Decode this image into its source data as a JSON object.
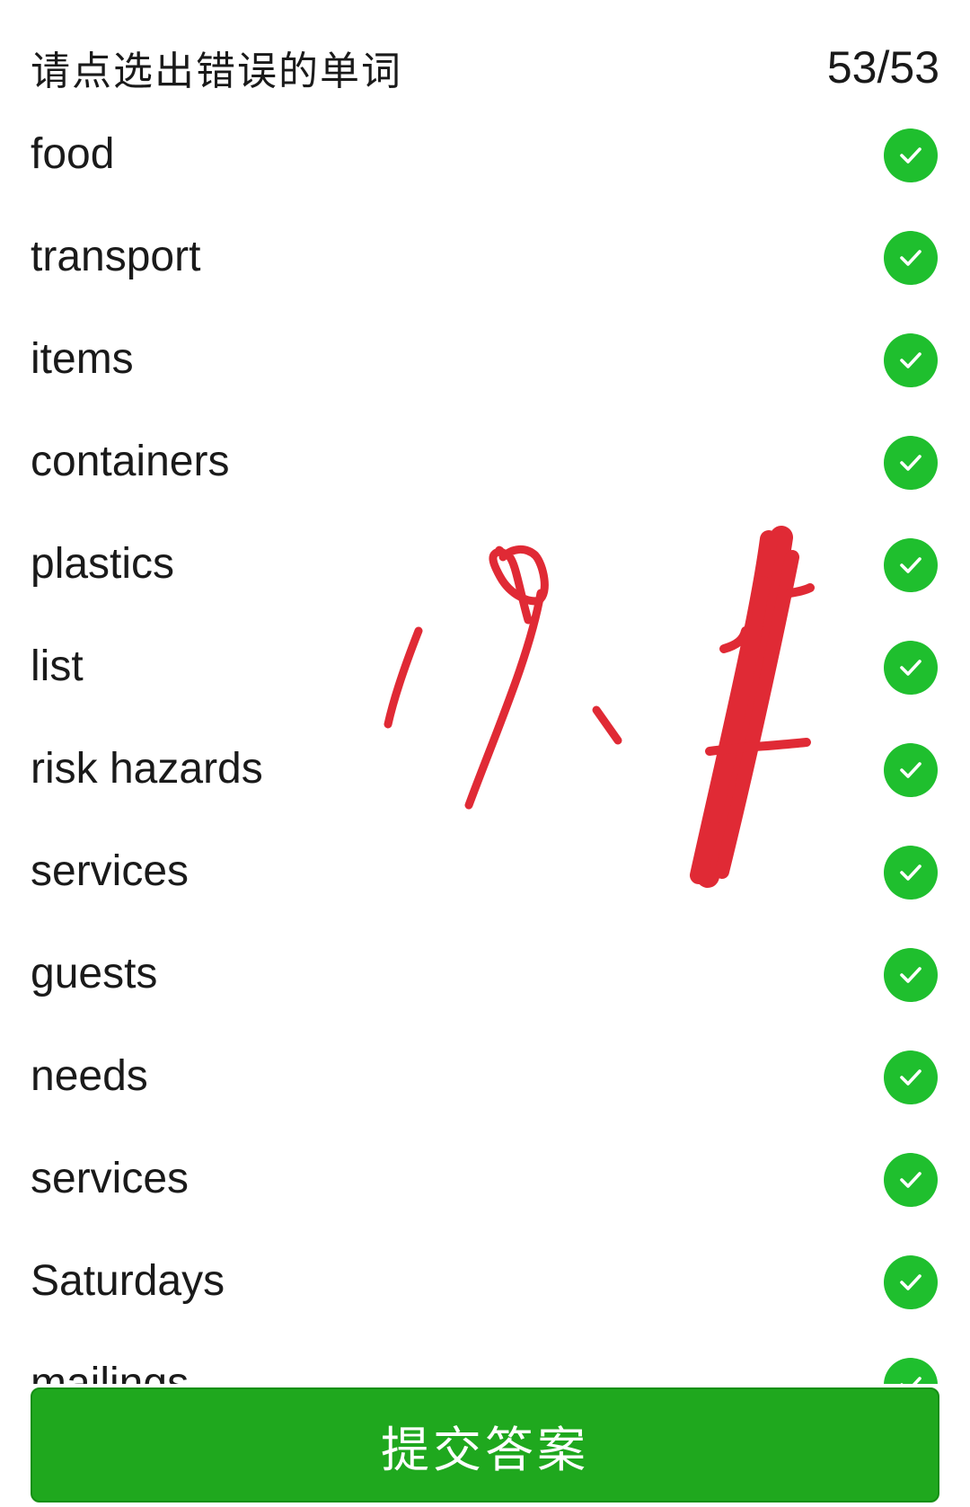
{
  "header": {
    "title": "请点选出错误的单词",
    "counter": "53/53"
  },
  "words": [
    {
      "text": "food",
      "status": "correct"
    },
    {
      "text": "transport",
      "status": "correct"
    },
    {
      "text": "items",
      "status": "correct"
    },
    {
      "text": "containers",
      "status": "correct"
    },
    {
      "text": "plastics",
      "status": "correct"
    },
    {
      "text": "list",
      "status": "correct"
    },
    {
      "text": "risk hazards",
      "status": "correct"
    },
    {
      "text": "services",
      "status": "correct"
    },
    {
      "text": "guests",
      "status": "correct"
    },
    {
      "text": "needs",
      "status": "correct"
    },
    {
      "text": "services",
      "status": "correct"
    },
    {
      "text": "Saturdays",
      "status": "correct"
    },
    {
      "text": "mailings",
      "status": "correct"
    }
  ],
  "submit": {
    "label": "提交答案"
  },
  "annotation": {
    "text": "19、+",
    "color": "#e02a35"
  },
  "colors": {
    "check_badge": "#1fbf2e",
    "submit_button": "#1fa81e"
  },
  "icons": {
    "row_status": "check-circle-icon"
  }
}
